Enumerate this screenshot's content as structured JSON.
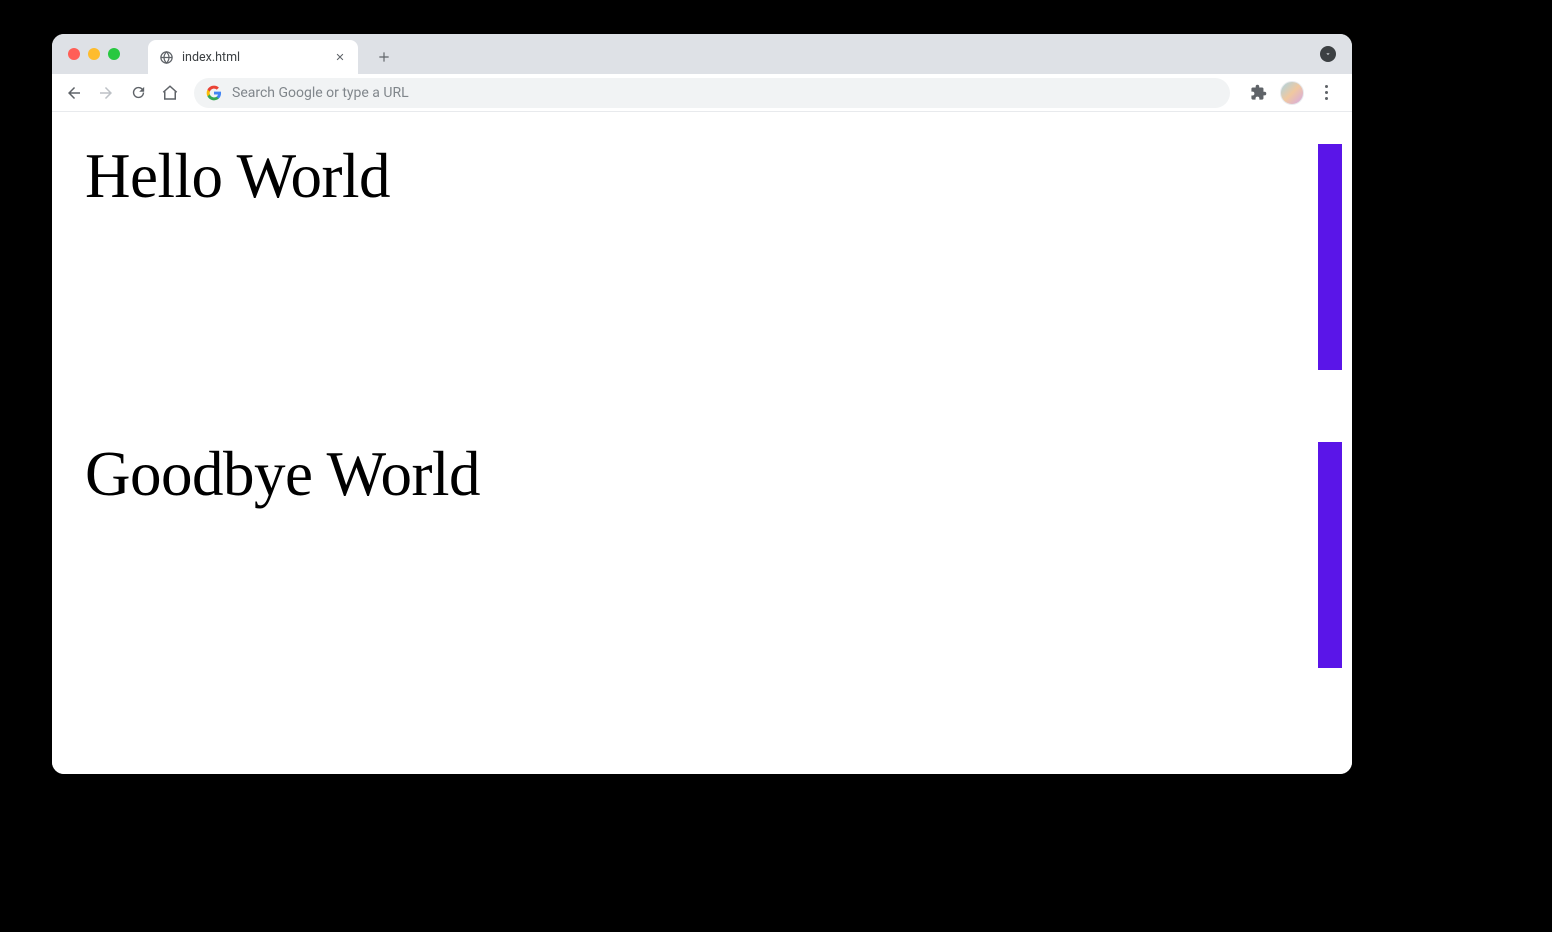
{
  "tab": {
    "title": "index.html"
  },
  "omnibox": {
    "placeholder": "Search Google or type a URL"
  },
  "page": {
    "heading1": "Hello World",
    "heading2": "Goodbye World"
  },
  "colors": {
    "accent_bar": "#5a15e8"
  }
}
